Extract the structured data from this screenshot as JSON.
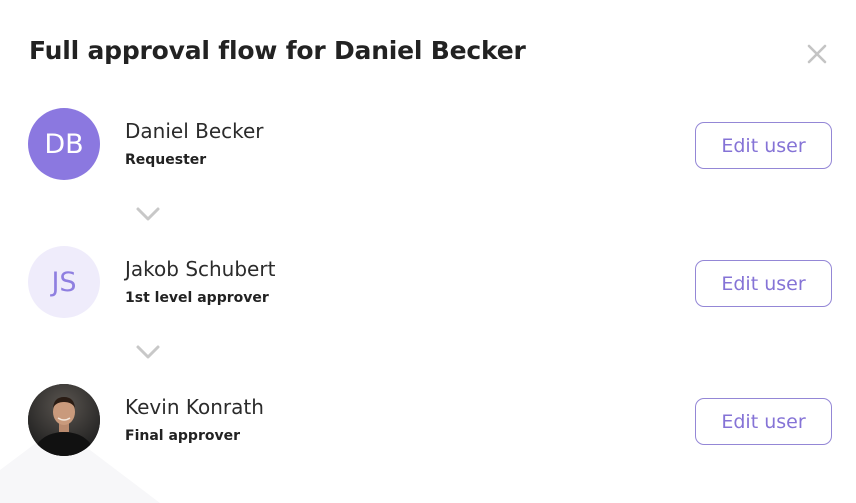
{
  "dialog": {
    "title": "Full approval flow for Daniel Becker",
    "close_icon": "close-icon"
  },
  "approvers": [
    {
      "initials": "DB",
      "name": "Daniel Becker",
      "role": "Requester",
      "edit_label": "Edit user",
      "avatar_style": "solid"
    },
    {
      "initials": "JS",
      "name": "Jakob Schubert",
      "role": "1st level approver",
      "edit_label": "Edit user",
      "avatar_style": "soft"
    },
    {
      "initials": "",
      "name": "Kevin Konrath",
      "role": "Final approver",
      "edit_label": "Edit user",
      "avatar_style": "photo"
    }
  ],
  "connector_icon": "chevron-down-icon",
  "colors": {
    "accent": "#8573d6",
    "avatar_solid": "#8b78e0",
    "avatar_soft_bg": "#efecfb",
    "chevron": "#c8c8c8"
  }
}
